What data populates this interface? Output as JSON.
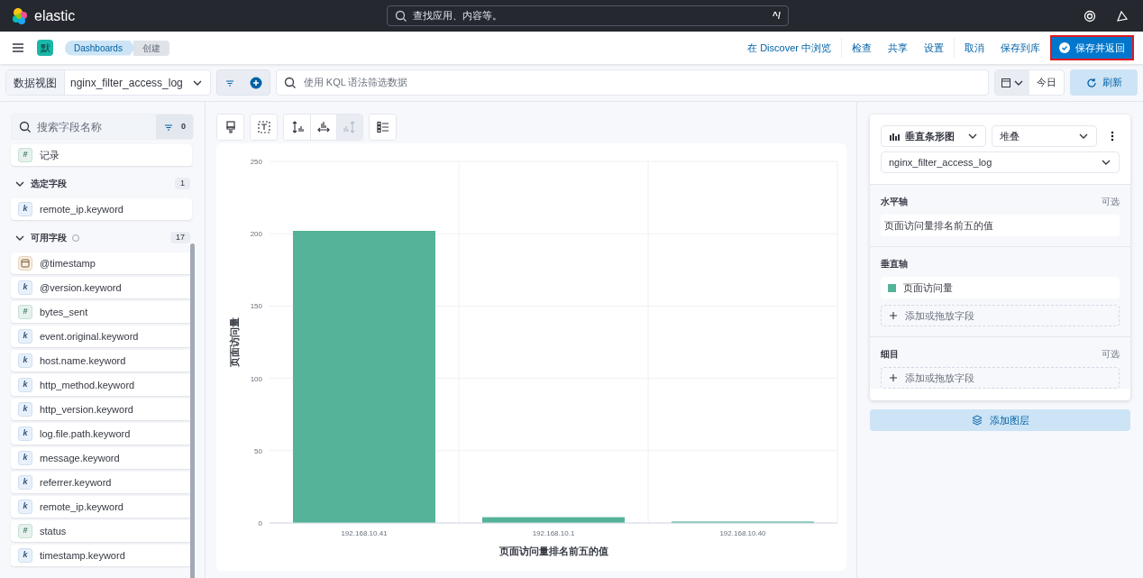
{
  "header": {
    "logo": "elastic",
    "search_placeholder": "查找应用、内容等。",
    "search_shortcut": "^/"
  },
  "nav": {
    "space": "默",
    "breadcrumbs": [
      {
        "label": "Dashboards",
        "selected": false
      },
      {
        "label": "创建",
        "selected": true
      }
    ],
    "actions": [
      {
        "label": "在 Discover 中浏览",
        "kind": "link"
      },
      {
        "label": "检查",
        "kind": "link"
      },
      {
        "label": "共享",
        "kind": "link"
      },
      {
        "label": "设置",
        "kind": "link"
      },
      {
        "label": "取消",
        "kind": "link"
      },
      {
        "label": "保存到库",
        "kind": "link"
      },
      {
        "label": "保存并返回",
        "kind": "primary"
      }
    ]
  },
  "query": {
    "data_view_label": "数据视图",
    "data_view": "nginx_filter_access_log",
    "placeholder": "使用 KQL 语法筛选数据",
    "date": "今日",
    "refresh": "刷新"
  },
  "fields": {
    "search_placeholder": "搜索字段名称",
    "filter_count": "0",
    "records": {
      "kind": "number",
      "token": "#",
      "name": "记录"
    },
    "groups": [
      {
        "title": "选定字段",
        "count": "1",
        "expanded": true,
        "help": false,
        "fields": [
          {
            "kind": "keyword",
            "token": "k",
            "name": "remote_ip.keyword"
          }
        ]
      },
      {
        "title": "可用字段",
        "count": "17",
        "expanded": true,
        "help": true,
        "fields": [
          {
            "kind": "date",
            "name": "@timestamp"
          },
          {
            "kind": "keyword",
            "token": "k",
            "name": "@version.keyword"
          },
          {
            "kind": "number",
            "token": "#",
            "name": "bytes_sent"
          },
          {
            "kind": "keyword",
            "token": "k",
            "name": "event.original.keyword"
          },
          {
            "kind": "keyword",
            "token": "k",
            "name": "host.name.keyword"
          },
          {
            "kind": "keyword",
            "token": "k",
            "name": "http_method.keyword"
          },
          {
            "kind": "keyword",
            "token": "k",
            "name": "http_version.keyword"
          },
          {
            "kind": "keyword",
            "token": "k",
            "name": "log.file.path.keyword"
          },
          {
            "kind": "keyword",
            "token": "k",
            "name": "message.keyword"
          },
          {
            "kind": "keyword",
            "token": "k",
            "name": "referrer.keyword"
          },
          {
            "kind": "keyword",
            "token": "k",
            "name": "remote_ip.keyword"
          },
          {
            "kind": "number",
            "token": "#",
            "name": "status"
          },
          {
            "kind": "keyword",
            "token": "k",
            "name": "timestamp.keyword"
          }
        ]
      }
    ]
  },
  "toolbar": [
    {
      "kind": "brush",
      "disabled": false
    },
    {
      "kind": "text",
      "disabled": false
    },
    {
      "kind": "left-axis",
      "disabled": false
    },
    {
      "kind": "bottom-axis",
      "disabled": false
    },
    {
      "kind": "right-axis",
      "disabled": true
    },
    {
      "kind": "legend",
      "disabled": false
    }
  ],
  "chart": {
    "chart_data": {
      "type": "bar",
      "xlabel": "页面访问量排名前五的值",
      "ylabel": "页面访问量",
      "categories": [
        "192.168.10.41",
        "192.168.10.1",
        "192.168.10.40"
      ],
      "series": [
        {
          "color": "#54b399",
          "values": [
            202,
            4,
            1
          ]
        }
      ],
      "ylim": [
        0,
        250
      ],
      "grid": true,
      "yticks": [
        0,
        50,
        100,
        150,
        200,
        250
      ]
    }
  },
  "config": {
    "chart_type": "垂直条形图",
    "mode": "堆叠",
    "data_view": "nginx_filter_access_log",
    "sections": [
      {
        "title": "水平轴",
        "optional": "可选",
        "items": [
          {
            "label": "页面访问量排名前五的值"
          }
        ]
      },
      {
        "title": "垂直轴",
        "items": [
          {
            "label": "页面访问量",
            "color": "#54b399"
          }
        ],
        "add": "添加或拖放字段"
      },
      {
        "title": "细目",
        "optional": "可选",
        "add": "添加或拖放字段"
      }
    ],
    "add_layer": "添加图层"
  }
}
